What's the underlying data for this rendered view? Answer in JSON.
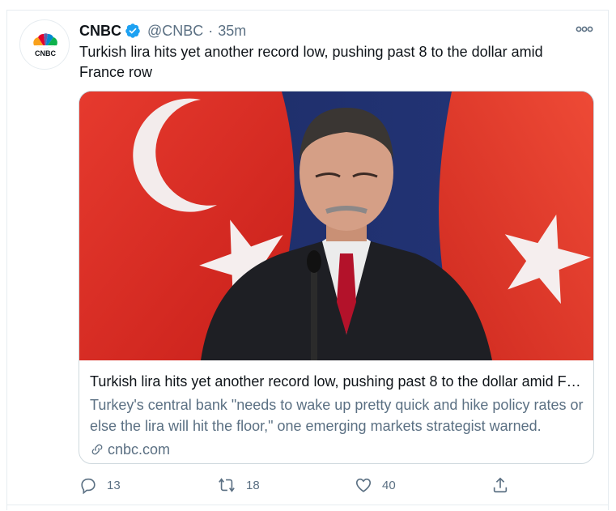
{
  "tweet": {
    "author_name": "CNBC",
    "handle": "@CNBC",
    "separator": "·",
    "time": "35m",
    "avatar_text": "CNBC",
    "text": "Turkish lira hits yet another record low, pushing past 8 to the dollar amid France row"
  },
  "card": {
    "title": "Turkish lira hits yet another record low, pushing past 8 to the dollar amid France row",
    "description": "Turkey's central bank \"needs to wake up pretty quick and hike policy rates or else the lira will hit the floor,\" one emerging markets strategist warned.",
    "domain": "cnbc.com"
  },
  "actions": {
    "reply_count": "13",
    "retweet_count": "18",
    "like_count": "40"
  },
  "icons": {
    "verified": "verified-badge-icon",
    "more": "more-horizontal-icon",
    "link": "link-icon",
    "reply": "reply-icon",
    "retweet": "retweet-icon",
    "like": "heart-icon",
    "share": "share-icon"
  },
  "colors": {
    "verified_blue": "#1da1f2",
    "secondary_text": "#5b7083",
    "border": "#cfd9de"
  }
}
